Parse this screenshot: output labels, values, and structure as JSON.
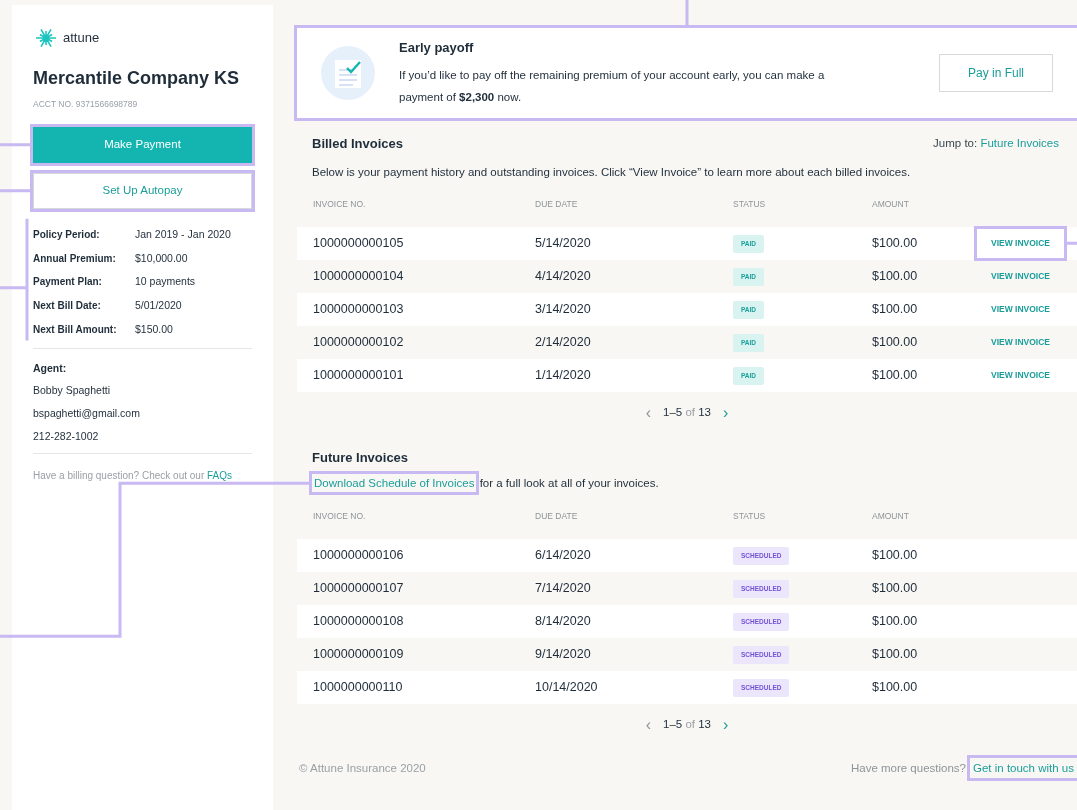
{
  "sidebar": {
    "logo": "attune",
    "company": "Mercantile Company KS",
    "account": "ACCT NO. 9371566698789",
    "buttons": [
      {
        "label": "Make Payment",
        "kind": "primary",
        "highlighted": true
      },
      {
        "label": "Set Up Autopay",
        "kind": "outline",
        "highlighted": true
      }
    ],
    "details_highlighted": true,
    "details": [
      {
        "label": "Policy Period:",
        "value": "Jan 2019 - Jan 2020"
      },
      {
        "label": "Annual Premium:",
        "value": "$10,000.00"
      },
      {
        "label": "Payment Plan:",
        "value": "10 payments"
      },
      {
        "label": "Next Bill Date:",
        "value": "5/01/2020"
      },
      {
        "label": "Next Bill Amount:",
        "value": "$150.00"
      }
    ],
    "agent": {
      "heading": "Agent:",
      "name": "Bobby Spaghetti",
      "email": "bspaghetti@gmail.com",
      "phone": "212-282-1002"
    },
    "help": {
      "text": "Have a billing question? Check out our",
      "link": "FAQs"
    }
  },
  "early_payoff": {
    "title": "Early payoff",
    "text": "If you’d like to pay off the remaining premium of your account early, you can make a payment of **$2,300** now.",
    "button": "Pay in Full",
    "highlighted": true
  },
  "billed": {
    "title": "Billed Invoices",
    "jump_label": "Jump to:",
    "jump_link": "Future Invoices",
    "description": "Below is your payment history and outstanding invoices. Click “View Invoice” to learn more about each billed invoices.",
    "columns": [
      "INVOICE NO.",
      "DUE DATE",
      "STATUS",
      "AMOUNT"
    ],
    "rows": [
      {
        "invoice": "1000000000105",
        "due": "5/14/2020",
        "status": "PAID",
        "amount": "$100.00",
        "action": "VIEW INVOICE",
        "highlighted": true
      },
      {
        "invoice": "1000000000104",
        "due": "4/14/2020",
        "status": "PAID",
        "amount": "$100.00",
        "action": "VIEW INVOICE",
        "highlighted": false
      },
      {
        "invoice": "1000000000103",
        "due": "3/14/2020",
        "status": "PAID",
        "amount": "$100.00",
        "action": "VIEW INVOICE",
        "highlighted": false
      },
      {
        "invoice": "1000000000102",
        "due": "2/14/2020",
        "status": "PAID",
        "amount": "$100.00",
        "action": "VIEW INVOICE",
        "highlighted": false
      },
      {
        "invoice": "1000000000101",
        "due": "1/14/2020",
        "status": "PAID",
        "amount": "$100.00",
        "action": "VIEW INVOICE",
        "highlighted": false
      }
    ],
    "pagination": {
      "prev": "‹",
      "range": "1–5",
      "of": "of",
      "total": "13",
      "next": "›"
    }
  },
  "future": {
    "title": "Future Invoices",
    "link": "Download Schedule of Invoices",
    "link_highlighted": true,
    "description": "for a full look at all of your invoices.",
    "columns": [
      "INVOICE NO.",
      "DUE DATE",
      "STATUS",
      "AMOUNT"
    ],
    "rows": [
      {
        "invoice": "1000000000106",
        "due": "6/14/2020",
        "status": "SCHEDULED",
        "amount": "$100.00"
      },
      {
        "invoice": "1000000000107",
        "due": "7/14/2020",
        "status": "SCHEDULED",
        "amount": "$100.00"
      },
      {
        "invoice": "1000000000108",
        "due": "8/14/2020",
        "status": "SCHEDULED",
        "amount": "$100.00"
      },
      {
        "invoice": "1000000000109",
        "due": "9/14/2020",
        "status": "SCHEDULED",
        "amount": "$100.00"
      },
      {
        "invoice": "1000000000110",
        "due": "10/14/2020",
        "status": "SCHEDULED",
        "amount": "$100.00"
      }
    ],
    "pagination": {
      "prev": "‹",
      "range": "1–5",
      "of": "of",
      "total": "13",
      "next": "›"
    }
  },
  "footer": {
    "copyright": "© Attune Insurance 2020",
    "question": "Have more questions?",
    "link": "Get in touch with us",
    "link_highlighted": true
  }
}
